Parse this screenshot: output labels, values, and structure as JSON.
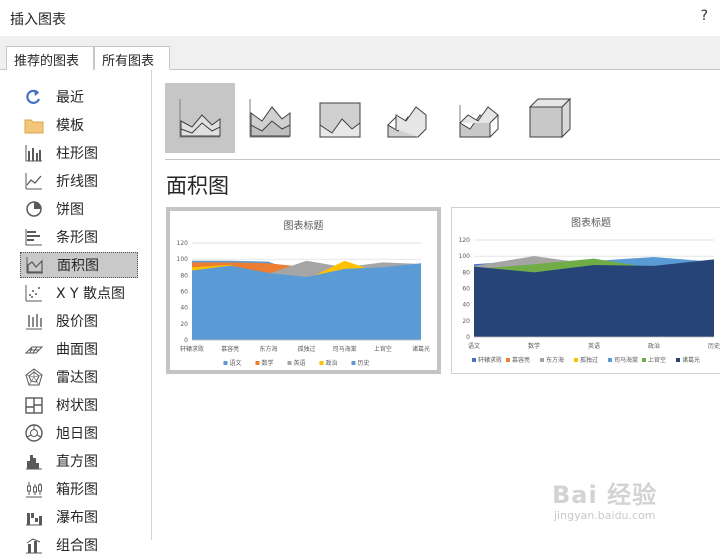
{
  "dialog": {
    "title": "插入图表",
    "help": "?"
  },
  "tabs": [
    {
      "label": "推荐的图表",
      "active": false
    },
    {
      "label": "所有图表",
      "active": true
    }
  ],
  "sidebar": {
    "items": [
      {
        "label": "最近",
        "icon": "recent-arrow-icon"
      },
      {
        "label": "模板",
        "icon": "folder-icon"
      },
      {
        "label": "柱形图",
        "icon": "column-chart-icon"
      },
      {
        "label": "折线图",
        "icon": "line-chart-icon"
      },
      {
        "label": "饼图",
        "icon": "pie-chart-icon"
      },
      {
        "label": "条形图",
        "icon": "bar-chart-icon"
      },
      {
        "label": "面积图",
        "icon": "area-chart-icon",
        "selected": true
      },
      {
        "label": "X Y 散点图",
        "icon": "scatter-chart-icon"
      },
      {
        "label": "股价图",
        "icon": "stock-chart-icon"
      },
      {
        "label": "曲面图",
        "icon": "surface-chart-icon"
      },
      {
        "label": "雷达图",
        "icon": "radar-chart-icon"
      },
      {
        "label": "树状图",
        "icon": "treemap-chart-icon"
      },
      {
        "label": "旭日图",
        "icon": "sunburst-chart-icon"
      },
      {
        "label": "直方图",
        "icon": "histogram-chart-icon"
      },
      {
        "label": "箱形图",
        "icon": "box-whisker-chart-icon"
      },
      {
        "label": "瀑布图",
        "icon": "waterfall-chart-icon"
      },
      {
        "label": "组合图",
        "icon": "combo-chart-icon"
      }
    ]
  },
  "subtypes": [
    {
      "icon": "area-icon",
      "selected": true
    },
    {
      "icon": "stacked-area-icon"
    },
    {
      "icon": "100-stacked-area-icon"
    },
    {
      "icon": "3d-area-icon"
    },
    {
      "icon": "3d-stacked-area-icon"
    },
    {
      "icon": "3d-100-stacked-area-icon"
    }
  ],
  "heading": "面积图",
  "colors": {
    "语文": "#5b9bd5",
    "数学": "#ed7d31",
    "英语": "#a5a5a5",
    "政治": "#ffc000",
    "历史": "#5b9bd5",
    "轩辕求败": "#4472c4",
    "慕容亮": "#ed7d31",
    "东方海": "#a5a5a5",
    "孤独过": "#ffc000",
    "司马海棠": "#5b9bd5",
    "上官空": "#70ad47",
    "诸葛光": "#264478"
  },
  "chart_data": [
    {
      "type": "area",
      "title": "图表标题",
      "categories": [
        "轩辕求败",
        "慕容亮",
        "东方海",
        "孤独过",
        "司马海棠",
        "上官空",
        "诸葛光"
      ],
      "ylim": [
        0,
        120
      ],
      "yticks": [
        0,
        20,
        40,
        60,
        80,
        100,
        120
      ],
      "legend_position": "bottom",
      "series": [
        {
          "name": "语文",
          "values": [
            98,
            98,
            97,
            80,
            92,
            88,
            95
          ]
        },
        {
          "name": "数学",
          "values": [
            96,
            96,
            95,
            90,
            89,
            92,
            93
          ]
        },
        {
          "name": "英语",
          "values": [
            89,
            88,
            82,
            98,
            90,
            96,
            94
          ]
        },
        {
          "name": "政治",
          "values": [
            90,
            93,
            76,
            75,
            98,
            82,
            92
          ]
        },
        {
          "name": "历史",
          "values": [
            86,
            92,
            83,
            78,
            88,
            90,
            95
          ]
        }
      ]
    },
    {
      "type": "area",
      "title": "图表标题",
      "categories": [
        "语文",
        "数学",
        "英语",
        "政治",
        "历史"
      ],
      "ylim": [
        0,
        120
      ],
      "yticks": [
        0,
        20,
        40,
        60,
        80,
        100,
        120
      ],
      "legend_position": "bottom",
      "series": [
        {
          "name": "轩辕求败",
          "values": [
            90,
            95,
            85,
            90,
            93
          ]
        },
        {
          "name": "慕容亮",
          "values": [
            86,
            98,
            88,
            89,
            92
          ]
        },
        {
          "name": "东方海",
          "values": [
            88,
            100,
            90,
            95,
            94
          ]
        },
        {
          "name": "孤独过",
          "values": [
            84,
            88,
            92,
            90,
            90
          ]
        },
        {
          "name": "司马海棠",
          "values": [
            85,
            82,
            94,
            99,
            93
          ]
        },
        {
          "name": "上官空",
          "values": [
            84,
            90,
            97,
            85,
            94
          ]
        },
        {
          "name": "诸葛光",
          "values": [
            87,
            80,
            89,
            88,
            96
          ]
        }
      ]
    }
  ],
  "watermark": {
    "main": "Bai 经验",
    "url": "jingyan.baidu.com"
  }
}
